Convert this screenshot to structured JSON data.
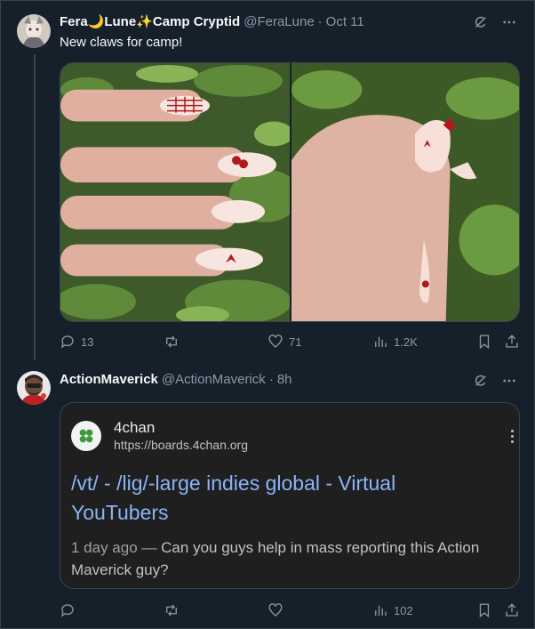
{
  "tweets": [
    {
      "display_name": "Fera🌙Lune✨Camp Cryptid",
      "handle": "@FeraLune",
      "separator": "·",
      "time": "Oct 11",
      "text": "New claws for camp!",
      "stats": {
        "replies": "13",
        "retweets": "",
        "likes": "71",
        "views": "1.2K"
      }
    },
    {
      "display_name": "ActionMaverick",
      "handle": "@ActionMaverick",
      "separator": "·",
      "time": "8h",
      "link_card": {
        "site_name": "4chan",
        "site_url": "https://boards.4chan.org",
        "title": "/vt/ - /lig/-large indies global - Virtual YouTubers",
        "date": "1 day ago",
        "dash": "—",
        "snippet": "Can you guys help in mass reporting this Action Maverick guy?"
      },
      "stats": {
        "replies": "",
        "retweets": "",
        "likes": "",
        "views": "102"
      }
    }
  ],
  "icons": {
    "grok": "grok-icon",
    "more": "more-icon",
    "reply": "reply-icon",
    "retweet": "retweet-icon",
    "like": "like-icon",
    "views": "views-icon",
    "bookmark": "bookmark-icon",
    "share": "share-icon"
  },
  "colors": {
    "background": "#15202b",
    "border": "#38444d",
    "secondary_text": "#8b98a5",
    "link_blue": "#8ab4f8",
    "card_bg": "#1f1f1f"
  }
}
